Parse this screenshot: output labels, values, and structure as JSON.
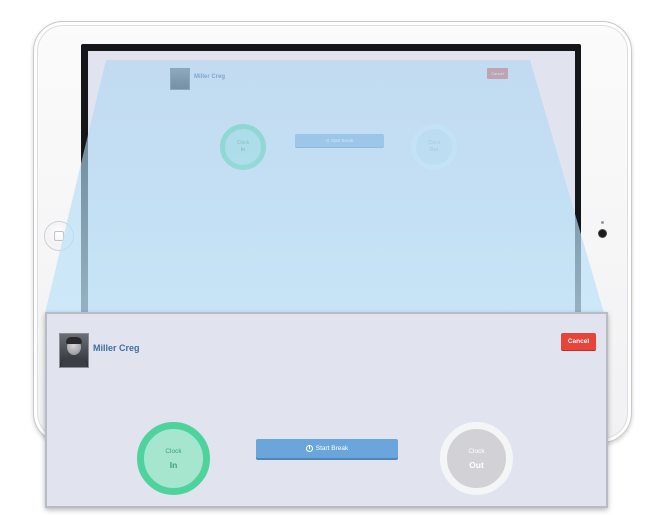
{
  "user": {
    "name": "Miller Creg"
  },
  "header": {
    "cancel_label": "Cancel"
  },
  "actions": {
    "start_break_label": "Start Break"
  },
  "clock_in": {
    "top": "Clock",
    "bottom": "In"
  },
  "clock_out": {
    "top": "Clock",
    "bottom": "Out"
  },
  "colors": {
    "accent_green": "#4fd39d",
    "accent_blue": "#6aa6dc",
    "danger_red": "#e8443a",
    "screen_bg": "#e1e3ee",
    "name_text": "#3f6fa0"
  },
  "icons": {
    "avatar": "user-photo",
    "break": "clock-icon",
    "home": "home-button-icon",
    "camera": "camera-icon"
  }
}
